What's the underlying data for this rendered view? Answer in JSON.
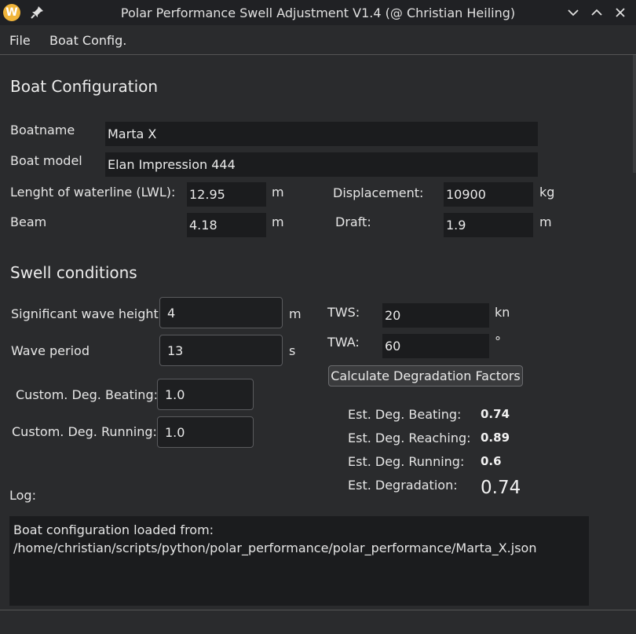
{
  "window": {
    "title": "Polar Performance Swell Adjustment V1.4 (@ Christian Heiling)",
    "logo_letter": "W",
    "accent_color": "#f0b43a"
  },
  "menu": {
    "file": "File",
    "boat_config": "Boat Config."
  },
  "boat": {
    "heading": "Boat Configuration",
    "name_label": "Boatname",
    "name_value": "Marta X",
    "model_label": "Boat model",
    "model_value": "Elan Impression 444",
    "lwl_label": "Lenght of waterline (LWL):",
    "lwl_value": "12.95",
    "lwl_unit": "m",
    "disp_label": "Displacement:",
    "disp_value": "10900",
    "disp_unit": "kg",
    "beam_label": "Beam",
    "beam_value": "4.18",
    "beam_unit": "m",
    "draft_label": "Draft:",
    "draft_value": "1.9",
    "draft_unit": "m"
  },
  "swell": {
    "heading": "Swell conditions",
    "wave_height_label": "Significant wave height:",
    "wave_height_value": "4",
    "wave_height_unit": "m",
    "wave_period_label": "Wave period",
    "wave_period_value": "13",
    "wave_period_unit": "s",
    "tws_label": "TWS:",
    "tws_value": "20",
    "tws_unit": "kn",
    "twa_label": "TWA:",
    "twa_value": "60",
    "twa_unit": "°",
    "custom_beating_label": "Custom. Deg. Beating:",
    "custom_beating_value": "1.0",
    "custom_running_label": "Custom. Deg. Running:",
    "custom_running_value": "1.0"
  },
  "calc": {
    "button_label": "Calculate Degradation Factors",
    "beating_label": "Est. Deg. Beating:",
    "beating_value": "0.74",
    "reaching_label": "Est. Deg. Reaching:",
    "reaching_value": "0.89",
    "running_label": "Est. Deg. Running:",
    "running_value": "0.6",
    "degradation_label": "Est. Degradation:",
    "degradation_value": "0.74"
  },
  "log": {
    "label": "Log:",
    "line1": "Boat configuration loaded from:",
    "line2": "/home/christian/scripts/python/polar_performance/polar_performance/Marta_X.json"
  }
}
